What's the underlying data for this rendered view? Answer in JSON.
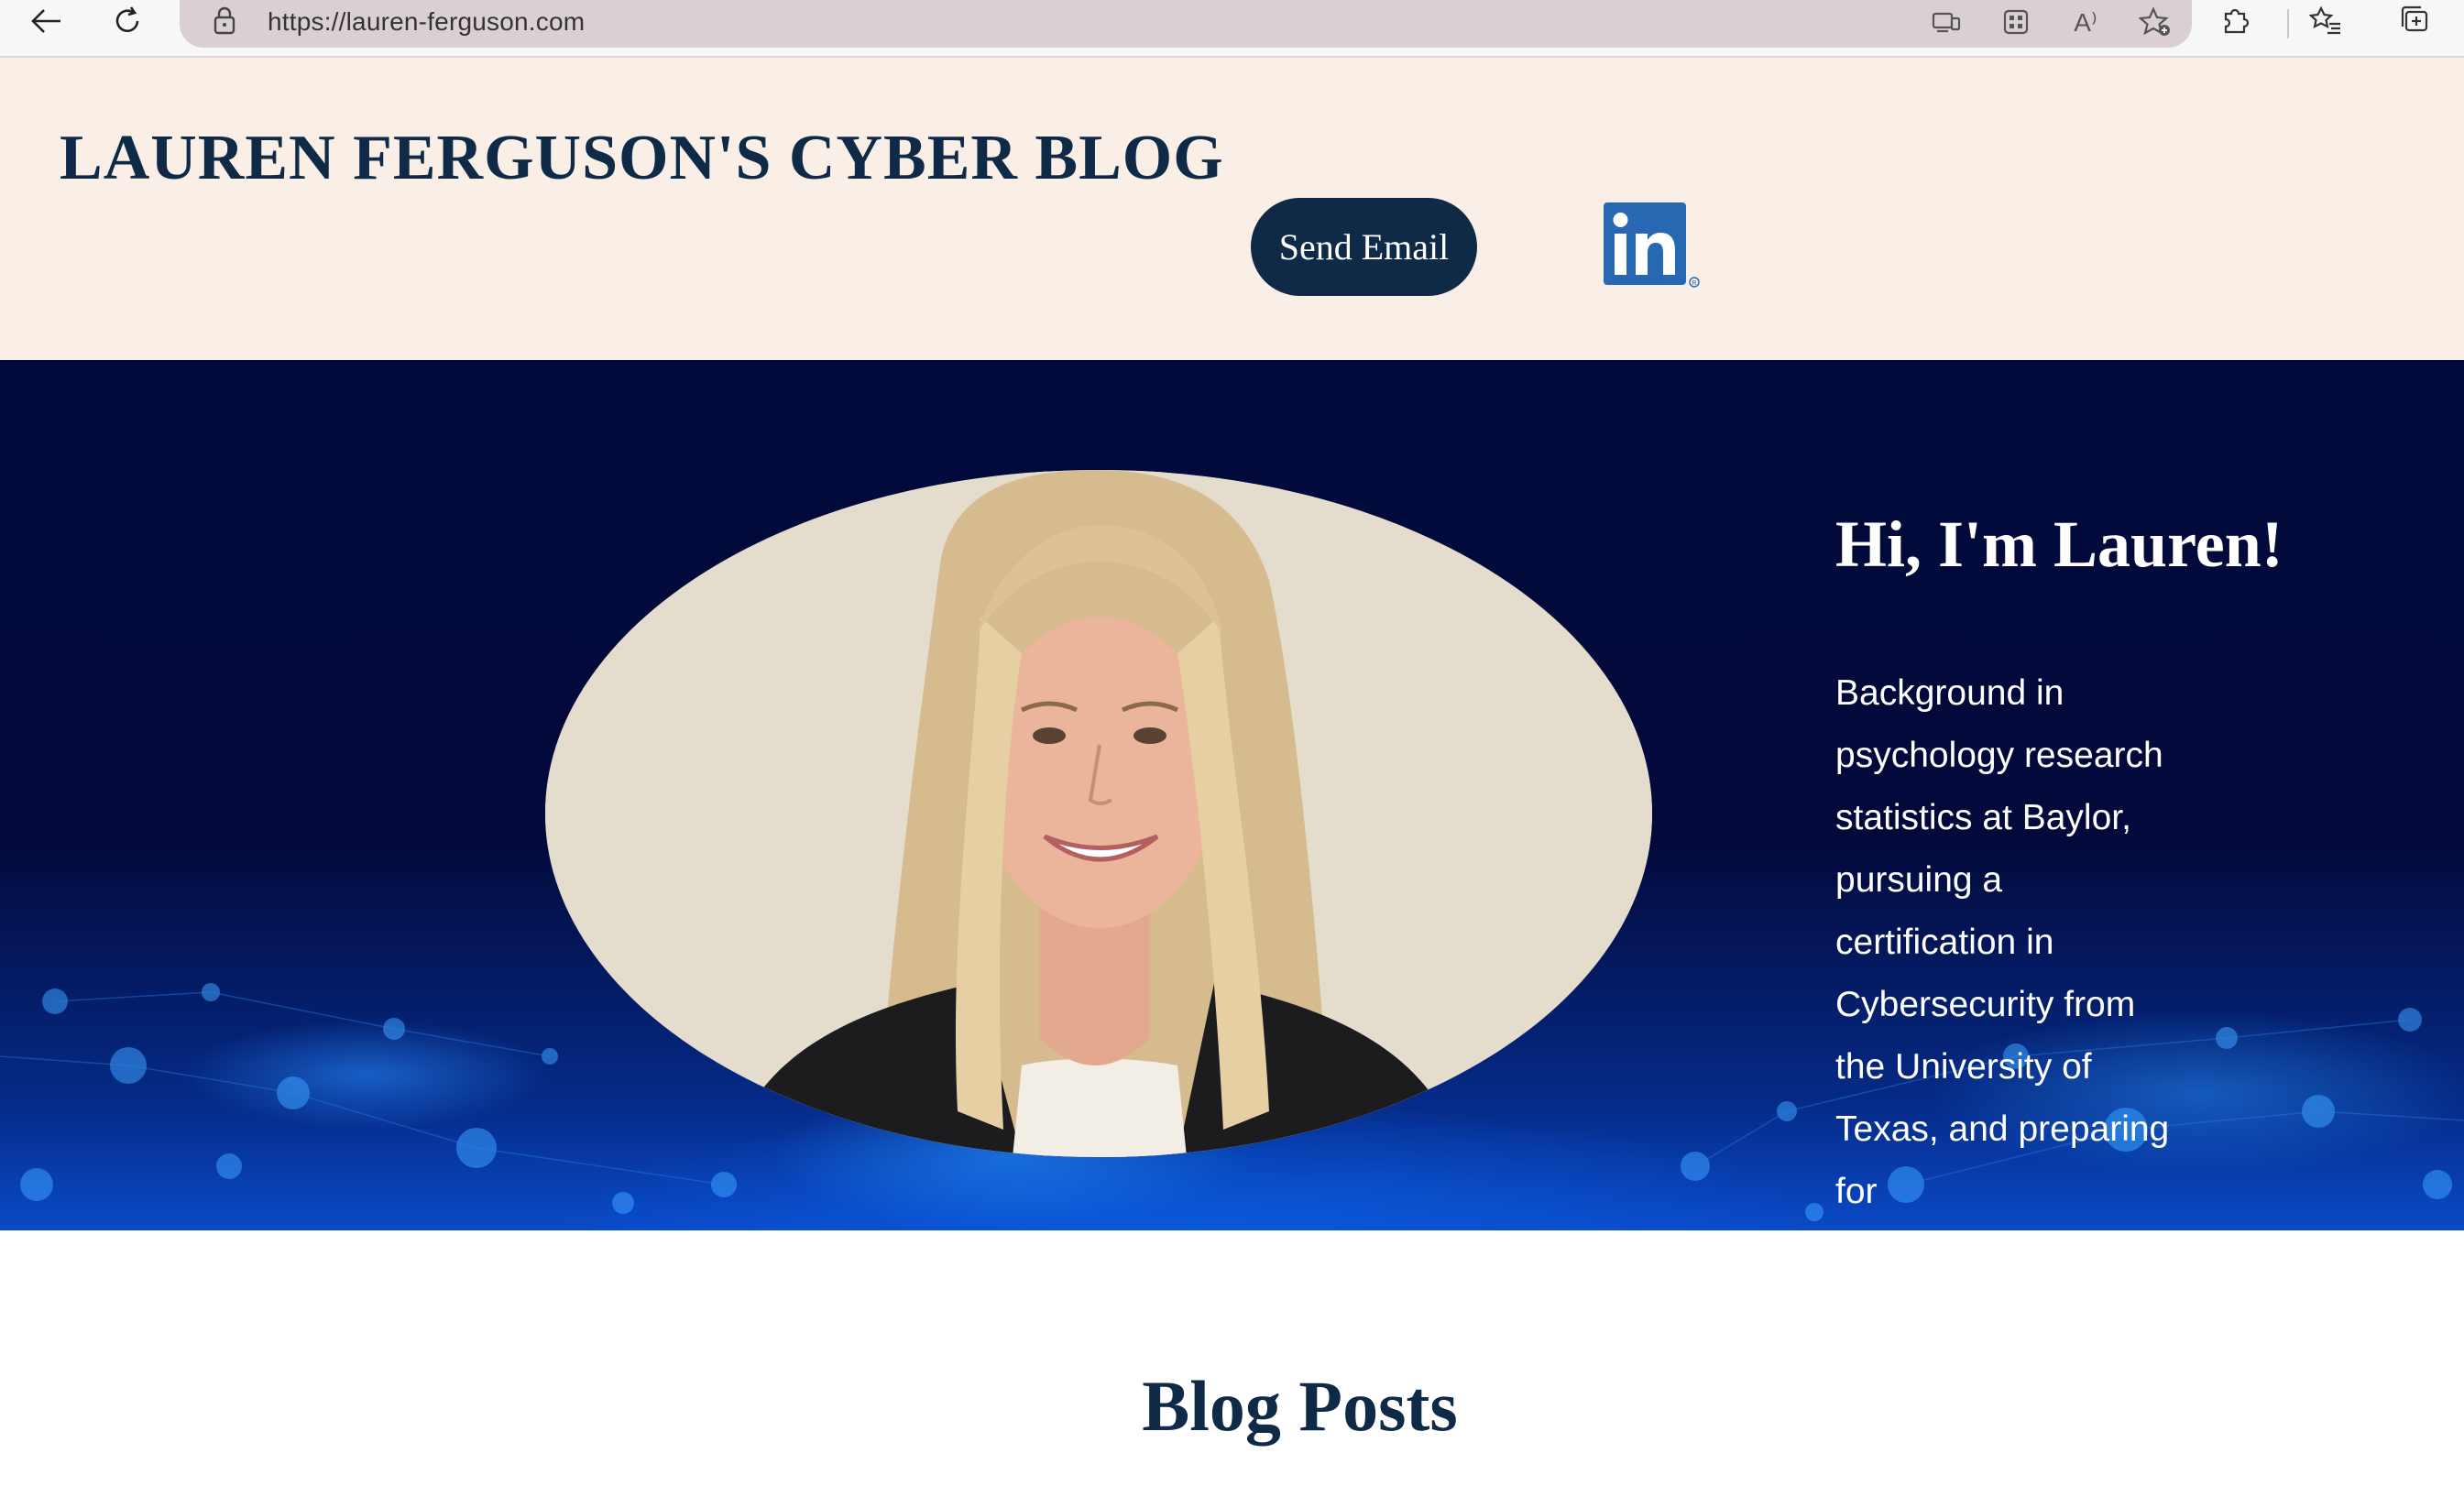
{
  "browser": {
    "url": "https://lauren-ferguson.com",
    "read_aloud_label": "A⁾"
  },
  "header": {
    "title": "LAUREN FERGUSON'S CYBER BLOG",
    "send_email_label": "Send Email",
    "linkedin_text": "in"
  },
  "hero": {
    "heading": "Hi, I'm Lauren!",
    "bio": "Background in psychology research statistics at Baylor, pursuing a certification in Cybersecurity from the University of Texas, and preparing for"
  },
  "blog": {
    "heading": "Blog Posts"
  },
  "colors": {
    "brand_navy": "#0e2a47",
    "header_bg": "#f9efe6",
    "linkedin_blue": "#2867b2"
  }
}
